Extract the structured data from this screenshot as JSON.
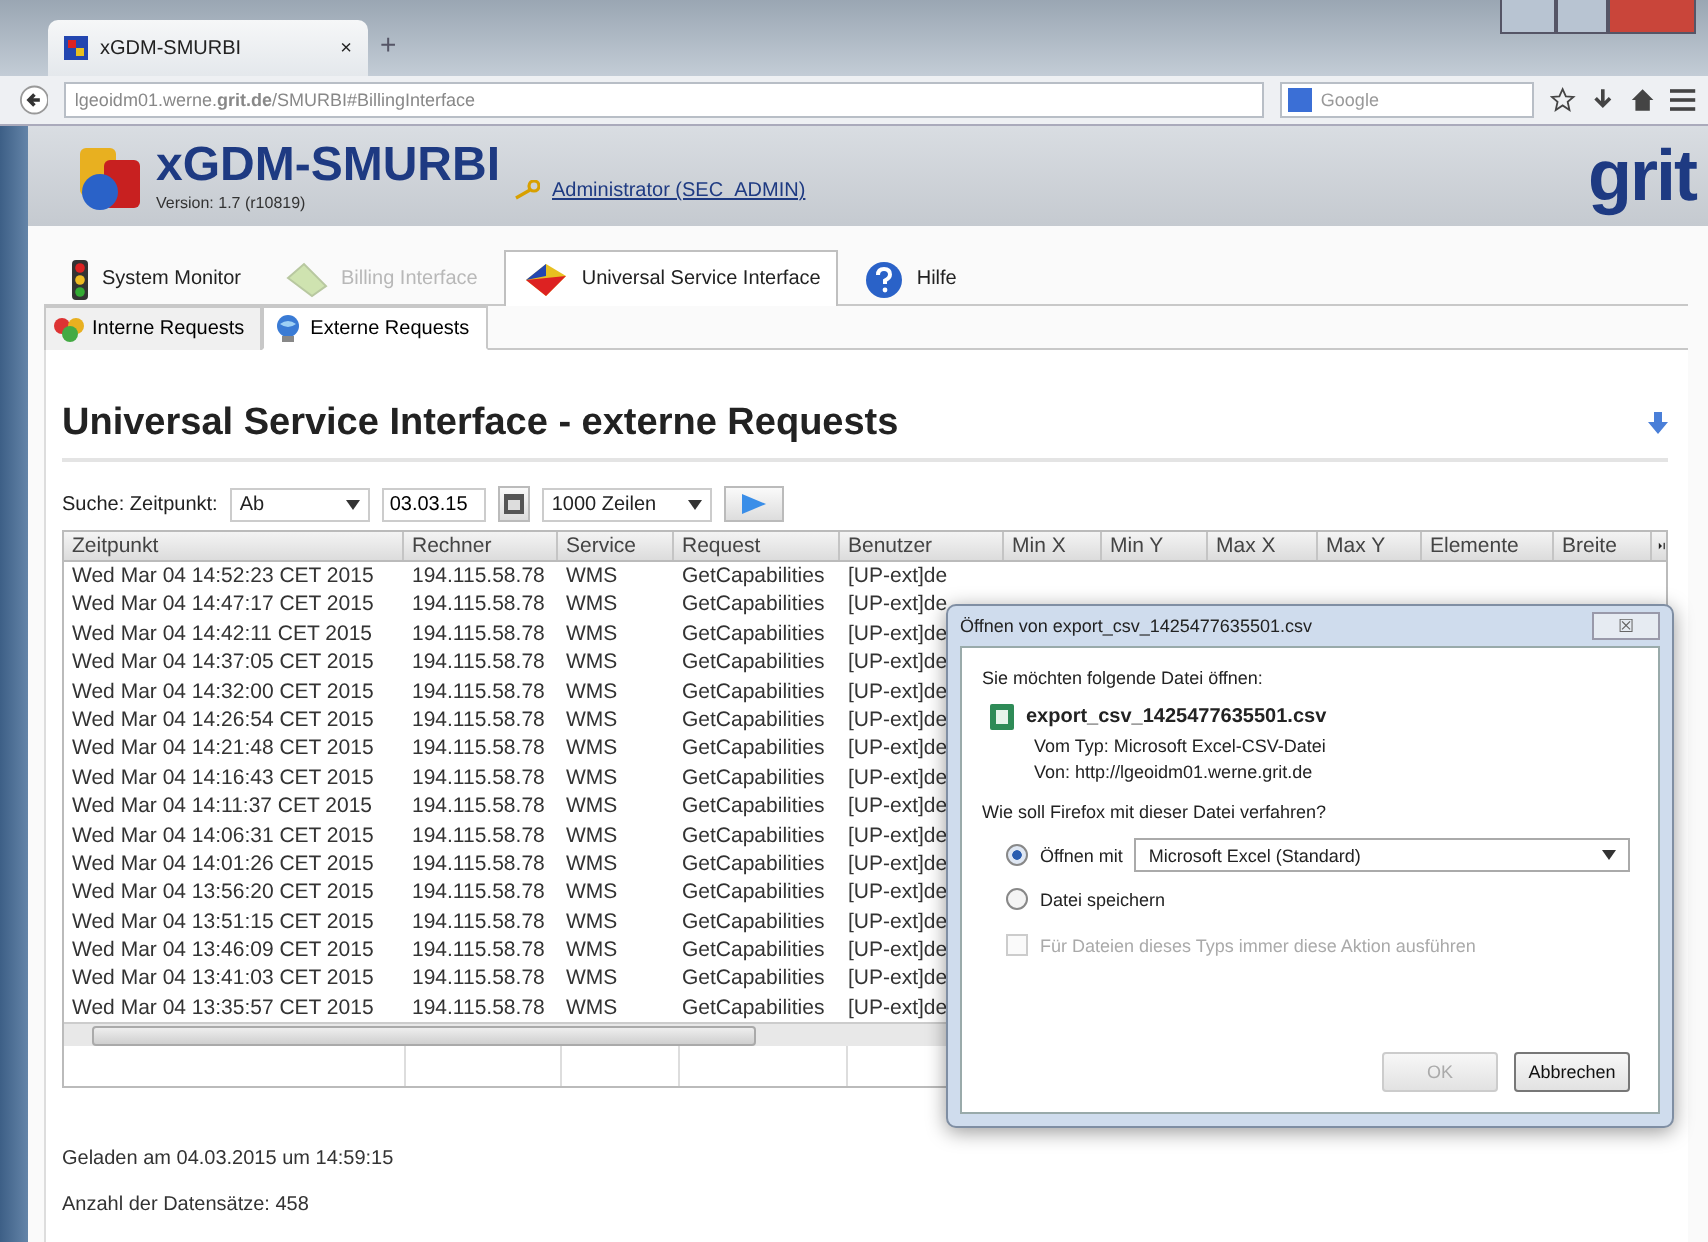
{
  "browser": {
    "tab_title": "xGDM-SMURBI",
    "tab_close": "×",
    "new_tab": "+",
    "address": "lgeoidm01.werne.**grit.de**/SMURBI#BillingInterface",
    "search_placeholder": "Google"
  },
  "header": {
    "app_name": "xGDM-SMURBI",
    "version": "Version: 1.7 (r10819)",
    "user_link": "Administrator (SEC_ADMIN)",
    "brand": "grit"
  },
  "tabs": [
    {
      "label": "System Monitor",
      "kind": "monitor",
      "selected": false,
      "disabled": false
    },
    {
      "label": "Billing Interface",
      "kind": "billing",
      "selected": false,
      "disabled": true
    },
    {
      "label": "Universal Service Interface",
      "kind": "universal",
      "selected": true,
      "disabled": false
    },
    {
      "label": "Hilfe",
      "kind": "help",
      "selected": false,
      "disabled": false
    }
  ],
  "subtabs": [
    {
      "label": "Interne Requests",
      "kind": "intern",
      "selected": false
    },
    {
      "label": "Externe Requests",
      "kind": "extern",
      "selected": true
    }
  ],
  "page_title": "Universal Service Interface - externe Requests",
  "search": {
    "label": "Suche: Zeitpunkt:",
    "mode": "Ab",
    "date": "03.03.15",
    "rows": "1000 Zeilen"
  },
  "table": {
    "columns": [
      "Zeitpunkt",
      "Rechner",
      "Service",
      "Request",
      "Benutzer",
      "Min X",
      "Min Y",
      "Max X",
      "Max Y",
      "Elemente",
      "Breite"
    ],
    "rows": [
      [
        "Wed Mar 04 14:52:23 CET 2015",
        "194.115.58.78",
        "WMS",
        "GetCapabilities",
        "[UP-ext]de"
      ],
      [
        "Wed Mar 04 14:47:17 CET 2015",
        "194.115.58.78",
        "WMS",
        "GetCapabilities",
        "[UP-ext]de"
      ],
      [
        "Wed Mar 04 14:42:11 CET 2015",
        "194.115.58.78",
        "WMS",
        "GetCapabilities",
        "[UP-ext]de"
      ],
      [
        "Wed Mar 04 14:37:05 CET 2015",
        "194.115.58.78",
        "WMS",
        "GetCapabilities",
        "[UP-ext]de"
      ],
      [
        "Wed Mar 04 14:32:00 CET 2015",
        "194.115.58.78",
        "WMS",
        "GetCapabilities",
        "[UP-ext]de"
      ],
      [
        "Wed Mar 04 14:26:54 CET 2015",
        "194.115.58.78",
        "WMS",
        "GetCapabilities",
        "[UP-ext]de"
      ],
      [
        "Wed Mar 04 14:21:48 CET 2015",
        "194.115.58.78",
        "WMS",
        "GetCapabilities",
        "[UP-ext]de"
      ],
      [
        "Wed Mar 04 14:16:43 CET 2015",
        "194.115.58.78",
        "WMS",
        "GetCapabilities",
        "[UP-ext]de"
      ],
      [
        "Wed Mar 04 14:11:37 CET 2015",
        "194.115.58.78",
        "WMS",
        "GetCapabilities",
        "[UP-ext]de"
      ],
      [
        "Wed Mar 04 14:06:31 CET 2015",
        "194.115.58.78",
        "WMS",
        "GetCapabilities",
        "[UP-ext]de"
      ],
      [
        "Wed Mar 04 14:01:26 CET 2015",
        "194.115.58.78",
        "WMS",
        "GetCapabilities",
        "[UP-ext]de"
      ],
      [
        "Wed Mar 04 13:56:20 CET 2015",
        "194.115.58.78",
        "WMS",
        "GetCapabilities",
        "[UP-ext]de"
      ],
      [
        "Wed Mar 04 13:51:15 CET 2015",
        "194.115.58.78",
        "WMS",
        "GetCapabilities",
        "[UP-ext]de"
      ],
      [
        "Wed Mar 04 13:46:09 CET 2015",
        "194.115.58.78",
        "WMS",
        "GetCapabilities",
        "[UP-ext]de"
      ],
      [
        "Wed Mar 04 13:41:03 CET 2015",
        "194.115.58.78",
        "WMS",
        "GetCapabilities",
        "[UP-ext]de"
      ],
      [
        "Wed Mar 04 13:35:57 CET 2015",
        "194.115.58.78",
        "WMS",
        "GetCapabilities",
        "[UP-ext]de"
      ]
    ]
  },
  "footer": {
    "loaded": "Geladen am 04.03.2015 um 14:59:15",
    "count": "Anzahl der Datensätze: 458"
  },
  "dialog": {
    "title": "Öffnen von export_csv_1425477635501.csv",
    "close": "☒",
    "intro": "Sie möchten folgende Datei öffnen:",
    "file_name": "export_csv_1425477635501.csv",
    "type": "Vom Typ: Microsoft Excel-CSV-Datei",
    "source": "Von: http://lgeoidm01.werne.grit.de",
    "question": "Wie soll Firefox mit dieser Datei verfahren?",
    "options": [
      {
        "label": "Öffnen mit",
        "selected": true
      },
      {
        "label": "Datei speichern",
        "selected": false
      }
    ],
    "application": "Microsoft Excel (Standard)",
    "remember": {
      "label": "Für Dateien dieses Typs immer diese Aktion ausführen",
      "checked": false,
      "disabled": true
    },
    "buttons": [
      {
        "label": "OK",
        "disabled": true
      },
      {
        "label": "Abbrechen",
        "disabled": false
      }
    ]
  }
}
